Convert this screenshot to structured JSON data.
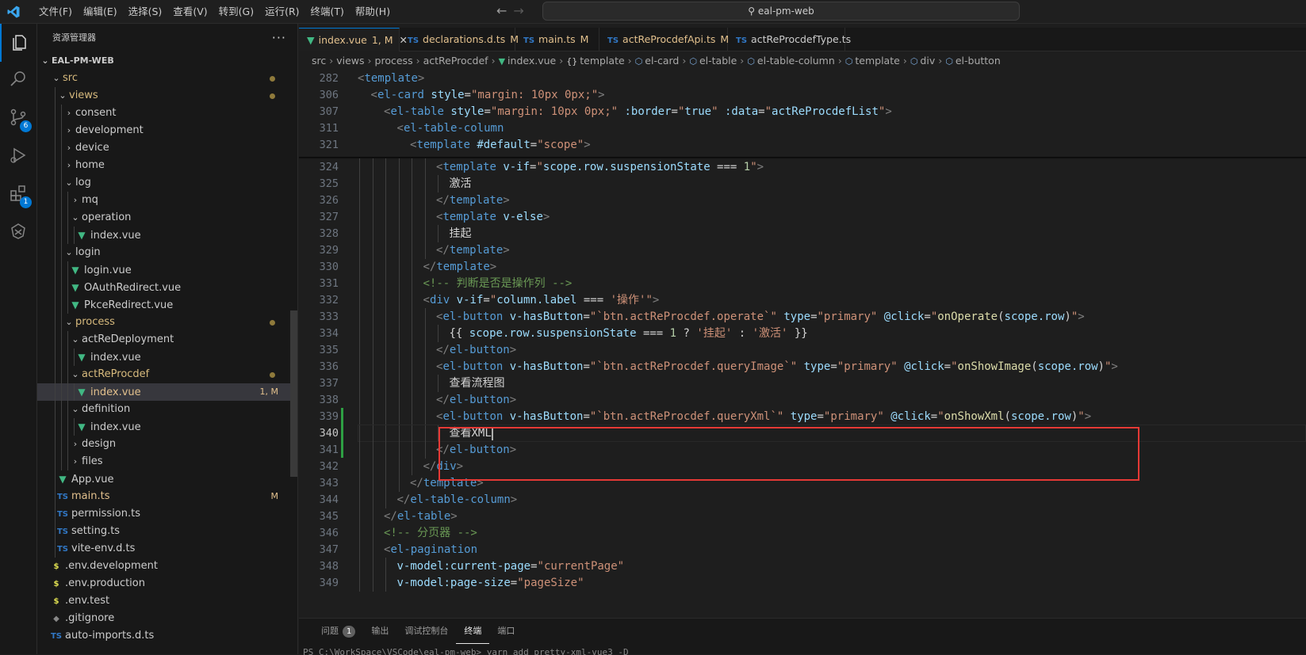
{
  "app": {
    "title": "eal-pm-web"
  },
  "menu": [
    "文件(F)",
    "编辑(E)",
    "选择(S)",
    "查看(V)",
    "转到(G)",
    "运行(R)",
    "终端(T)",
    "帮助(H)"
  ],
  "activity": {
    "scm_badge": "6",
    "ext_badge": "1"
  },
  "sidebar": {
    "title": "资源管理器",
    "more": "···",
    "root": "EAL-PM-WEB",
    "items": [
      {
        "label": "src",
        "depth": 1,
        "type": "folder",
        "open": true,
        "style": "folder-mod",
        "dot": true
      },
      {
        "label": "views",
        "depth": 2,
        "type": "folder",
        "open": true,
        "style": "folder-mod",
        "dot": true
      },
      {
        "label": "consent",
        "depth": 3,
        "type": "folder",
        "open": false
      },
      {
        "label": "development",
        "depth": 3,
        "type": "folder",
        "open": false
      },
      {
        "label": "device",
        "depth": 3,
        "type": "folder",
        "open": false
      },
      {
        "label": "home",
        "depth": 3,
        "type": "folder",
        "open": false
      },
      {
        "label": "log",
        "depth": 3,
        "type": "folder",
        "open": true
      },
      {
        "label": "mq",
        "depth": 4,
        "type": "folder",
        "open": false
      },
      {
        "label": "operation",
        "depth": 4,
        "type": "folder",
        "open": true
      },
      {
        "label": "index.vue",
        "depth": 5,
        "type": "vue"
      },
      {
        "label": "login",
        "depth": 3,
        "type": "folder",
        "open": true
      },
      {
        "label": "login.vue",
        "depth": 4,
        "type": "vue"
      },
      {
        "label": "OAuthRedirect.vue",
        "depth": 4,
        "type": "vue"
      },
      {
        "label": "PkceRedirect.vue",
        "depth": 4,
        "type": "vue"
      },
      {
        "label": "process",
        "depth": 3,
        "type": "folder",
        "open": true,
        "style": "folder-mod",
        "dot": true
      },
      {
        "label": "actReDeployment",
        "depth": 4,
        "type": "folder",
        "open": true
      },
      {
        "label": "index.vue",
        "depth": 5,
        "type": "vue"
      },
      {
        "label": "actReProcdef",
        "depth": 4,
        "type": "folder",
        "open": true,
        "style": "folder-mod",
        "dot": true
      },
      {
        "label": "index.vue",
        "depth": 5,
        "type": "vue",
        "style": "file-mod",
        "selected": true,
        "dec": "1, M"
      },
      {
        "label": "definition",
        "depth": 4,
        "type": "folder",
        "open": true
      },
      {
        "label": "index.vue",
        "depth": 5,
        "type": "vue"
      },
      {
        "label": "design",
        "depth": 4,
        "type": "folder",
        "open": false
      },
      {
        "label": "files",
        "depth": 4,
        "type": "folder",
        "open": false
      },
      {
        "label": "App.vue",
        "depth": 2,
        "type": "vue"
      },
      {
        "label": "main.ts",
        "depth": 2,
        "type": "ts",
        "style": "file-mod",
        "dec": "M"
      },
      {
        "label": "permission.ts",
        "depth": 2,
        "type": "ts"
      },
      {
        "label": "setting.ts",
        "depth": 2,
        "type": "ts"
      },
      {
        "label": "vite-env.d.ts",
        "depth": 2,
        "type": "ts"
      },
      {
        "label": ".env.development",
        "depth": 1,
        "type": "env"
      },
      {
        "label": ".env.production",
        "depth": 1,
        "type": "env"
      },
      {
        "label": ".env.test",
        "depth": 1,
        "type": "env"
      },
      {
        "label": ".gitignore",
        "depth": 1,
        "type": "git"
      },
      {
        "label": "auto-imports.d.ts",
        "depth": 1,
        "type": "ts"
      }
    ]
  },
  "tabs": [
    {
      "label": "index.vue",
      "type": "vue",
      "active": true,
      "status": "1, M",
      "close": "✕"
    },
    {
      "label": "declarations.d.ts",
      "type": "ts",
      "status": "M"
    },
    {
      "label": "main.ts",
      "type": "ts",
      "status": "M"
    },
    {
      "label": "actReProcdefApi.ts",
      "type": "ts",
      "status": "M"
    },
    {
      "label": "actReProcdefType.ts",
      "type": "ts",
      "status": ""
    }
  ],
  "breadcrumb": [
    "src",
    "views",
    "process",
    "actReProcdef",
    "index.vue",
    "template",
    "el-card",
    "el-table",
    "el-table-column",
    "template",
    "div",
    "el-button"
  ],
  "sticky": [
    {
      "num": "282",
      "indent": 0,
      "toks": [
        [
          "br",
          "<"
        ],
        [
          "tag",
          "template"
        ],
        [
          "br",
          ">"
        ]
      ]
    },
    {
      "num": "306",
      "indent": 1,
      "toks": [
        [
          "br",
          "<"
        ],
        [
          "tag",
          "el-card"
        ],
        [
          "txt",
          " "
        ],
        [
          "attr",
          "style"
        ],
        [
          "op",
          "="
        ],
        [
          "str",
          "\"margin: 10px 0px;\""
        ],
        [
          "br",
          ">"
        ]
      ]
    },
    {
      "num": "307",
      "indent": 2,
      "toks": [
        [
          "br",
          "<"
        ],
        [
          "tag",
          "el-table"
        ],
        [
          "txt",
          " "
        ],
        [
          "attr",
          "style"
        ],
        [
          "op",
          "="
        ],
        [
          "str",
          "\"margin: 10px 0px;\""
        ],
        [
          "txt",
          " "
        ],
        [
          "attr",
          ":border"
        ],
        [
          "op",
          "="
        ],
        [
          "str",
          "\""
        ],
        [
          "attr",
          "true"
        ],
        [
          "str",
          "\""
        ],
        [
          "txt",
          " "
        ],
        [
          "attr",
          ":data"
        ],
        [
          "op",
          "="
        ],
        [
          "str",
          "\""
        ],
        [
          "attr",
          "actReProcdefList"
        ],
        [
          "str",
          "\""
        ],
        [
          "br",
          ">"
        ]
      ]
    },
    {
      "num": "311",
      "indent": 3,
      "toks": [
        [
          "br",
          "<"
        ],
        [
          "tag",
          "el-table-column"
        ]
      ]
    },
    {
      "num": "321",
      "indent": 4,
      "toks": [
        [
          "br",
          "<"
        ],
        [
          "tag",
          "template"
        ],
        [
          "txt",
          " "
        ],
        [
          "attr",
          "#default"
        ],
        [
          "op",
          "="
        ],
        [
          "str",
          "\"scope\""
        ],
        [
          "br",
          ">"
        ]
      ]
    }
  ],
  "lines": [
    {
      "num": "324",
      "indent": 6,
      "toks": [
        [
          "br",
          "<"
        ],
        [
          "tag",
          "template"
        ],
        [
          "txt",
          " "
        ],
        [
          "attr",
          "v-if"
        ],
        [
          "op",
          "="
        ],
        [
          "str",
          "\""
        ],
        [
          "attr",
          "scope.row.suspensionState"
        ],
        [
          "op",
          " === "
        ],
        [
          "num",
          "1"
        ],
        [
          "str",
          "\""
        ],
        [
          "br",
          ">"
        ]
      ]
    },
    {
      "num": "325",
      "indent": 7,
      "toks": [
        [
          "txt",
          "激活"
        ]
      ]
    },
    {
      "num": "326",
      "indent": 6,
      "toks": [
        [
          "br",
          "</"
        ],
        [
          "tag",
          "template"
        ],
        [
          "br",
          ">"
        ]
      ]
    },
    {
      "num": "327",
      "indent": 6,
      "toks": [
        [
          "br",
          "<"
        ],
        [
          "tag",
          "template"
        ],
        [
          "txt",
          " "
        ],
        [
          "attr",
          "v-else"
        ],
        [
          "br",
          ">"
        ]
      ]
    },
    {
      "num": "328",
      "indent": 7,
      "toks": [
        [
          "txt",
          "挂起"
        ]
      ]
    },
    {
      "num": "329",
      "indent": 6,
      "toks": [
        [
          "br",
          "</"
        ],
        [
          "tag",
          "template"
        ],
        [
          "br",
          ">"
        ]
      ]
    },
    {
      "num": "330",
      "indent": 5,
      "toks": [
        [
          "br",
          "</"
        ],
        [
          "tag",
          "template"
        ],
        [
          "br",
          ">"
        ]
      ]
    },
    {
      "num": "331",
      "indent": 5,
      "toks": [
        [
          "com",
          "<!-- 判断是否是操作列 -->"
        ]
      ]
    },
    {
      "num": "332",
      "indent": 5,
      "toks": [
        [
          "br",
          "<"
        ],
        [
          "tag",
          "div"
        ],
        [
          "txt",
          " "
        ],
        [
          "attr",
          "v-if"
        ],
        [
          "op",
          "="
        ],
        [
          "str",
          "\""
        ],
        [
          "attr",
          "column.label"
        ],
        [
          "op",
          " === "
        ],
        [
          "str",
          "'操作'"
        ],
        [
          "str",
          "\""
        ],
        [
          "br",
          ">"
        ]
      ]
    },
    {
      "num": "333",
      "indent": 6,
      "toks": [
        [
          "br",
          "<"
        ],
        [
          "tag",
          "el-button"
        ],
        [
          "txt",
          " "
        ],
        [
          "attr",
          "v-hasButton"
        ],
        [
          "op",
          "="
        ],
        [
          "str",
          "\"`btn.actReProcdef.operate`\""
        ],
        [
          "txt",
          " "
        ],
        [
          "attr",
          "type"
        ],
        [
          "op",
          "="
        ],
        [
          "str",
          "\"primary\""
        ],
        [
          "txt",
          " "
        ],
        [
          "attr",
          "@click"
        ],
        [
          "op",
          "="
        ],
        [
          "str",
          "\""
        ],
        [
          "fn",
          "onOperate"
        ],
        [
          "op",
          "("
        ],
        [
          "attr",
          "scope.row"
        ],
        [
          "op",
          ")"
        ],
        [
          "str",
          "\""
        ],
        [
          "br",
          ">"
        ]
      ]
    },
    {
      "num": "334",
      "indent": 7,
      "toks": [
        [
          "txt",
          "{{ "
        ],
        [
          "attr",
          "scope.row.suspensionState"
        ],
        [
          "op",
          " === "
        ],
        [
          "num",
          "1"
        ],
        [
          "op",
          " ? "
        ],
        [
          "str",
          "'挂起'"
        ],
        [
          "op",
          " : "
        ],
        [
          "str",
          "'激活'"
        ],
        [
          "txt",
          " }}"
        ]
      ]
    },
    {
      "num": "335",
      "indent": 6,
      "toks": [
        [
          "br",
          "</"
        ],
        [
          "tag",
          "el-button"
        ],
        [
          "br",
          ">"
        ]
      ]
    },
    {
      "num": "336",
      "indent": 6,
      "toks": [
        [
          "br",
          "<"
        ],
        [
          "tag",
          "el-button"
        ],
        [
          "txt",
          " "
        ],
        [
          "attr",
          "v-hasButton"
        ],
        [
          "op",
          "="
        ],
        [
          "str",
          "\"`btn.actReProcdef.queryImage`\""
        ],
        [
          "txt",
          " "
        ],
        [
          "attr",
          "type"
        ],
        [
          "op",
          "="
        ],
        [
          "str",
          "\"primary\""
        ],
        [
          "txt",
          " "
        ],
        [
          "attr",
          "@click"
        ],
        [
          "op",
          "="
        ],
        [
          "str",
          "\""
        ],
        [
          "fn",
          "onShowImage"
        ],
        [
          "op",
          "("
        ],
        [
          "attr",
          "scope.row"
        ],
        [
          "op",
          ")"
        ],
        [
          "str",
          "\""
        ],
        [
          "br",
          ">"
        ]
      ]
    },
    {
      "num": "337",
      "indent": 7,
      "toks": [
        [
          "txt",
          "查看流程图"
        ]
      ]
    },
    {
      "num": "338",
      "indent": 6,
      "toks": [
        [
          "br",
          "</"
        ],
        [
          "tag",
          "el-button"
        ],
        [
          "br",
          ">"
        ]
      ]
    },
    {
      "num": "339",
      "indent": 6,
      "toks": [
        [
          "br",
          "<"
        ],
        [
          "tag",
          "el-button"
        ],
        [
          "txt",
          " "
        ],
        [
          "attr",
          "v-hasButton"
        ],
        [
          "op",
          "="
        ],
        [
          "str",
          "\"`btn.actReProcdef.queryXml`\""
        ],
        [
          "txt",
          " "
        ],
        [
          "attr",
          "type"
        ],
        [
          "op",
          "="
        ],
        [
          "str",
          "\"primary\""
        ],
        [
          "txt",
          " "
        ],
        [
          "attr",
          "@click"
        ],
        [
          "op",
          "="
        ],
        [
          "str",
          "\""
        ],
        [
          "fn",
          "onShowXml"
        ],
        [
          "op",
          "("
        ],
        [
          "attr",
          "scope.row"
        ],
        [
          "op",
          ")"
        ],
        [
          "str",
          "\""
        ],
        [
          "br",
          ">"
        ]
      ]
    },
    {
      "num": "340",
      "indent": 7,
      "cur": true,
      "toks": [
        [
          "txt",
          "查看XML"
        ]
      ]
    },
    {
      "num": "341",
      "indent": 6,
      "toks": [
        [
          "br",
          "</"
        ],
        [
          "tag",
          "el-button"
        ],
        [
          "br",
          ">"
        ]
      ]
    },
    {
      "num": "342",
      "indent": 5,
      "toks": [
        [
          "br",
          "</"
        ],
        [
          "tag",
          "div"
        ],
        [
          "br",
          ">"
        ]
      ]
    },
    {
      "num": "343",
      "indent": 4,
      "toks": [
        [
          "br",
          "</"
        ],
        [
          "tag",
          "template"
        ],
        [
          "br",
          ">"
        ]
      ]
    },
    {
      "num": "344",
      "indent": 3,
      "toks": [
        [
          "br",
          "</"
        ],
        [
          "tag",
          "el-table-column"
        ],
        [
          "br",
          ">"
        ]
      ]
    },
    {
      "num": "345",
      "indent": 2,
      "toks": [
        [
          "br",
          "</"
        ],
        [
          "tag",
          "el-table"
        ],
        [
          "br",
          ">"
        ]
      ]
    },
    {
      "num": "346",
      "indent": 2,
      "toks": [
        [
          "com",
          "<!-- 分页器 -->"
        ]
      ]
    },
    {
      "num": "347",
      "indent": 2,
      "toks": [
        [
          "br",
          "<"
        ],
        [
          "tag",
          "el-pagination"
        ]
      ]
    },
    {
      "num": "348",
      "indent": 3,
      "toks": [
        [
          "attr",
          "v-model:current-page"
        ],
        [
          "op",
          "="
        ],
        [
          "str",
          "\"currentPage\""
        ]
      ]
    },
    {
      "num": "349",
      "indent": 3,
      "toks": [
        [
          "attr",
          "v-model:page-size"
        ],
        [
          "op",
          "="
        ],
        [
          "str",
          "\"pageSize\""
        ]
      ]
    }
  ],
  "panel": {
    "tabs": [
      {
        "label": "问题",
        "badge": "1"
      },
      {
        "label": "输出"
      },
      {
        "label": "调试控制台"
      },
      {
        "label": "终端",
        "active": true
      },
      {
        "label": "端口"
      }
    ],
    "terminal": "PS C:\\WorkSpace\\VSCode\\eal-pm-web> yarn add pretty-xml-vue3 -D"
  },
  "colors": {
    "accent": "#0078d4",
    "highlight": "#e53935",
    "git_added": "#2ea043"
  }
}
